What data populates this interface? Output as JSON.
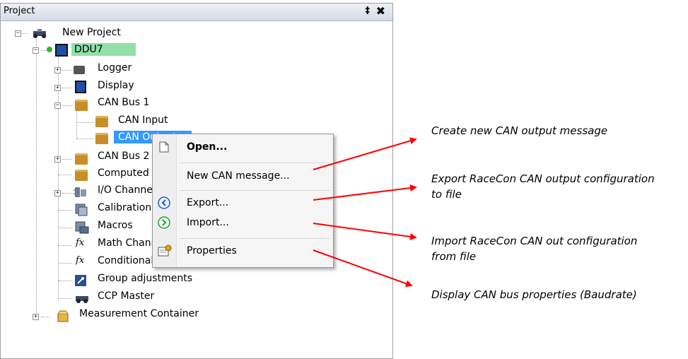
{
  "panel": {
    "title": "Project",
    "pin_glyph": "‡",
    "close_glyph": "✖"
  },
  "tree": {
    "project": "New Project",
    "device": "DDU7",
    "logger": "Logger",
    "display": "Display",
    "canbus1": "CAN Bus 1",
    "can_input": "CAN Input",
    "can_output": "CAN Output",
    "canbus2": "CAN Bus 2",
    "computed": "Computed Channels",
    "io": "I/O Channels",
    "calibration": "Calibration",
    "macros": "Macros",
    "math": "Math Channels",
    "conditional": "Conditional Channels",
    "group": "Group adjustments",
    "ccp": "CCP Master",
    "measurement": "Measurement Container"
  },
  "context_menu": {
    "open": "Open...",
    "new_can": "New CAN message...",
    "export": "Export...",
    "import": "Import...",
    "properties": "Properties"
  },
  "annotations": {
    "a1": "Create new CAN output message",
    "a2_line1": "Export RaceCon CAN output configuration",
    "a2_line2": "to file",
    "a3_line1": "Import RaceCon CAN out configuration",
    "a3_line2": "from file",
    "a4": "Display CAN bus properties (Baudrate)"
  },
  "colors": {
    "arrow": "#ff0000",
    "selected_device": "#90e0a8",
    "selected_item": "#3399ff"
  }
}
